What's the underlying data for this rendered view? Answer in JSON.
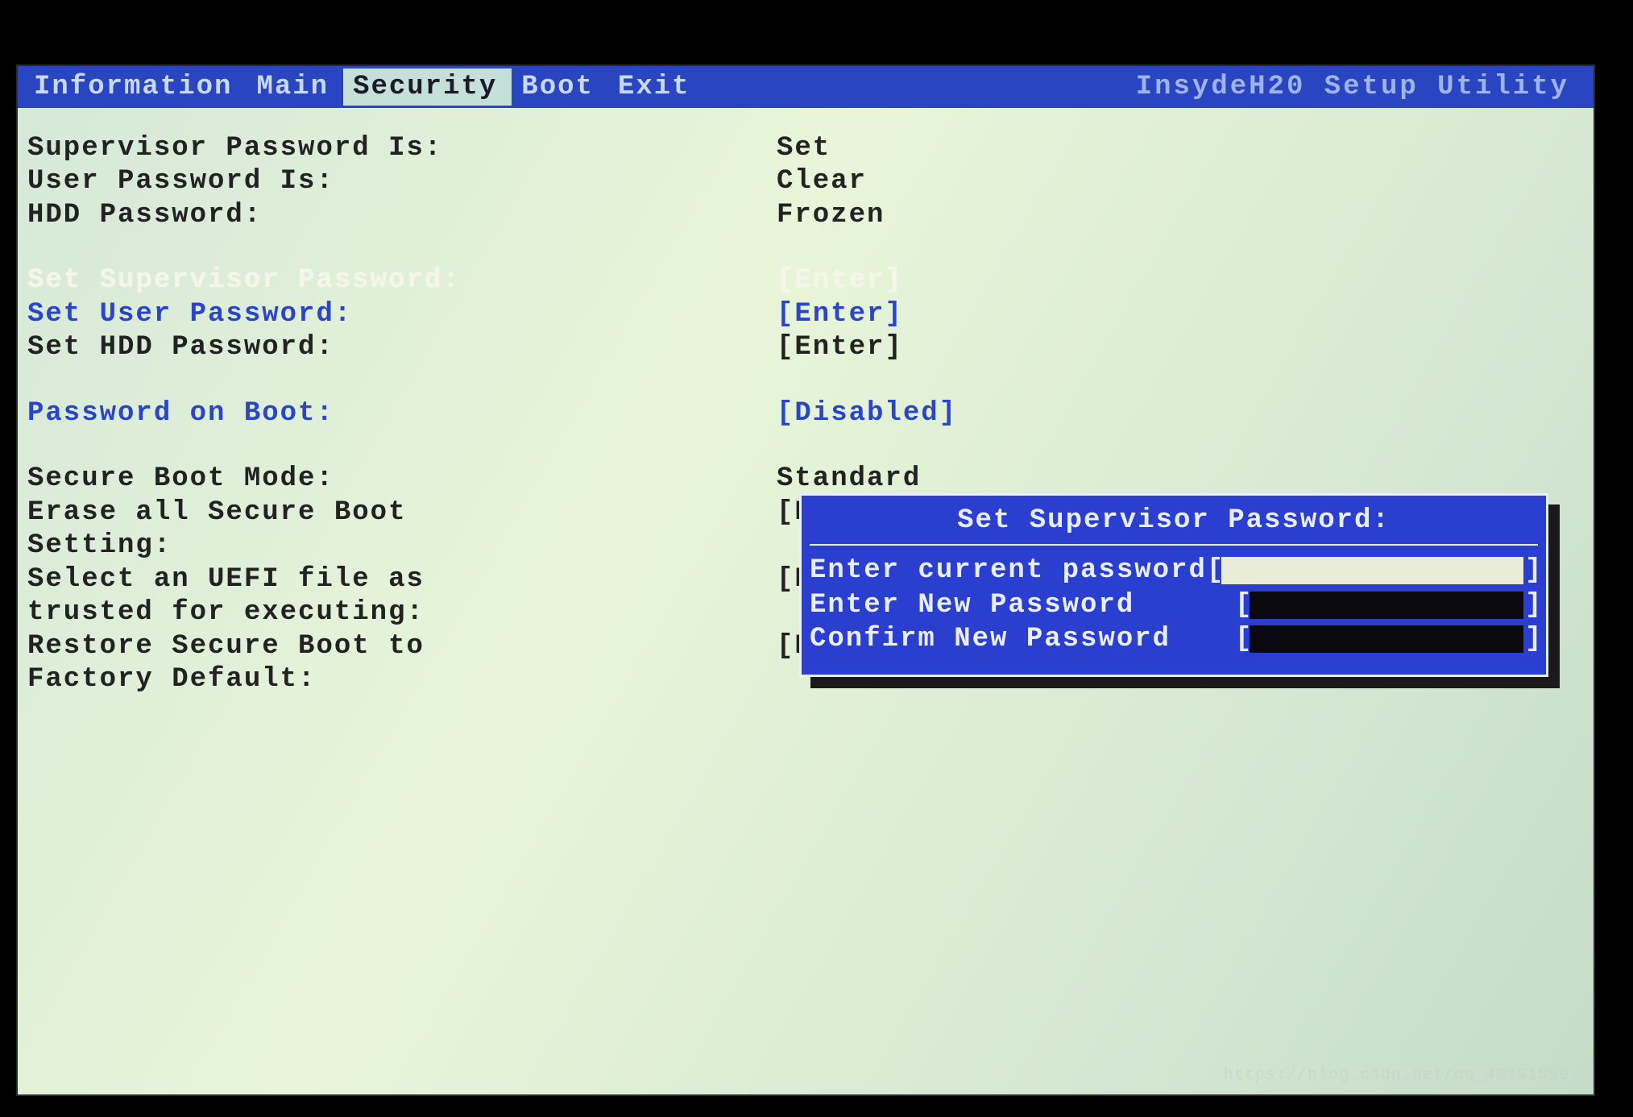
{
  "brand": "InsydeH20 Setup Utility",
  "tabs": {
    "information": "Information",
    "main": "Main",
    "security": "Security",
    "boot": "Boot",
    "exit": "Exit"
  },
  "rows": {
    "supervisor_pw_is": {
      "label": "Supervisor Password Is:",
      "value": "Set"
    },
    "user_pw_is": {
      "label": "User Password Is:",
      "value": "Clear"
    },
    "hdd_pw": {
      "label": "HDD Password:",
      "value": "Frozen"
    },
    "set_sup_pw": {
      "label": "Set Supervisor Password:",
      "value": "[Enter]"
    },
    "set_user_pw": {
      "label": "Set User Password:",
      "value": "[Enter]"
    },
    "set_hdd_pw": {
      "label": "Set HDD Password:",
      "value": "[Enter]"
    },
    "pw_on_boot": {
      "label": "Password on Boot:",
      "value": "[Disabled]"
    },
    "secure_mode": {
      "label": "Secure Boot Mode:",
      "value": "Standard"
    },
    "erase_l1": {
      "label": "Erase all Secure Boot",
      "value": "[Enter]"
    },
    "erase_l2": {
      "label": "Setting:",
      "value": ""
    },
    "uefi_l1": {
      "label": "Select an UEFI file as",
      "value": "[E"
    },
    "uefi_l2": {
      "label": "trusted for executing:",
      "value": ""
    },
    "restore_l1": {
      "label": "Restore Secure Boot to",
      "value": "[E"
    },
    "restore_l2": {
      "label": "Factory Default:",
      "value": ""
    }
  },
  "dialog": {
    "title": "Set Supervisor Password:",
    "current": "Enter current password",
    "new": "Enter New Password",
    "confirm": "Confirm New Password",
    "lb": "[",
    "rb": "]"
  },
  "watermark": "https://blog.csdn.net/qq_40391559"
}
